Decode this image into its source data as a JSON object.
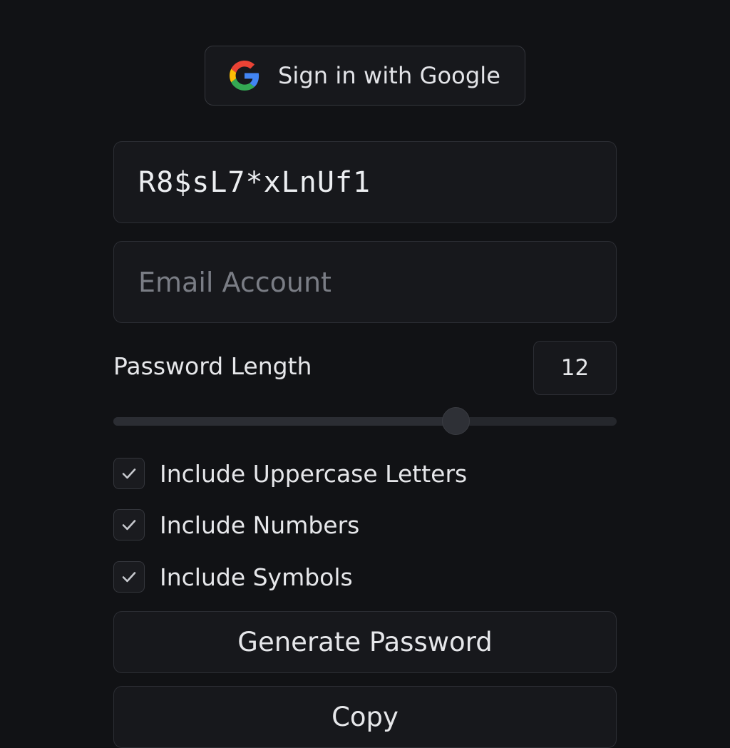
{
  "google_button": {
    "label": "Sign in with Google",
    "icon": "google-g-icon"
  },
  "password": {
    "value": "R8$sL7*xLnUf1"
  },
  "email": {
    "value": "",
    "placeholder": "Email Account"
  },
  "length": {
    "label": "Password Length",
    "value": "12",
    "slider_fraction": 0.68
  },
  "options": [
    {
      "label": "Include Uppercase Letters",
      "checked": true,
      "icon": "checkmark-icon"
    },
    {
      "label": "Include Numbers",
      "checked": true,
      "icon": "checkmark-icon"
    },
    {
      "label": "Include Symbols",
      "checked": true,
      "icon": "checkmark-icon"
    }
  ],
  "actions": {
    "generate_label": "Generate Password",
    "copy_label": "Copy"
  },
  "colors": {
    "background": "#111215",
    "surface": "#17181c",
    "border": "#2c2e34",
    "text": "#e6e7ea",
    "placeholder": "#7a7d85",
    "google_blue": "#4285F4",
    "google_red": "#EA4335",
    "google_yellow": "#FBBC05",
    "google_green": "#34A853"
  }
}
